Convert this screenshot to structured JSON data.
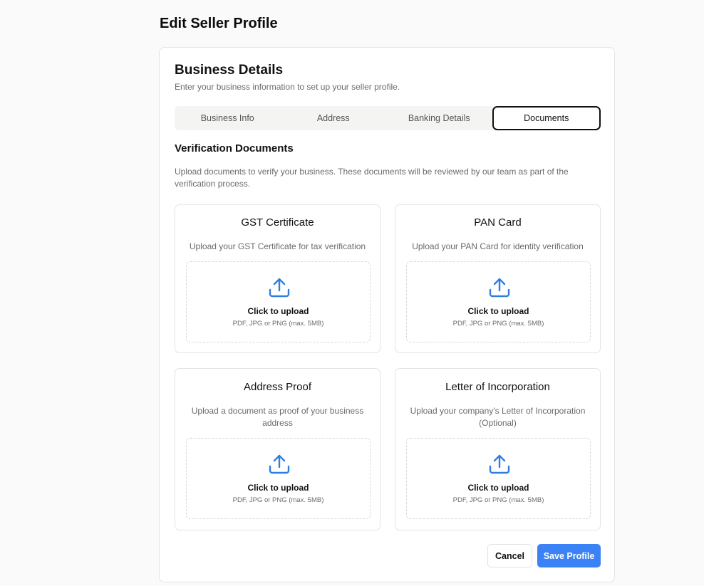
{
  "page": {
    "title": "Edit Seller Profile"
  },
  "card": {
    "title": "Business Details",
    "subtitle": "Enter your business information to set up your seller profile."
  },
  "tabs": [
    {
      "label": "Business Info",
      "active": false
    },
    {
      "label": "Address",
      "active": false
    },
    {
      "label": "Banking Details",
      "active": false
    },
    {
      "label": "Documents",
      "active": true
    }
  ],
  "section": {
    "title": "Verification Documents",
    "description": "Upload documents to verify your business. These documents will be reviewed by our team as part of the verification process."
  },
  "documents": [
    {
      "title": "GST Certificate",
      "description": "Upload your GST Certificate for tax verification",
      "upload_label": "Click to upload",
      "upload_hint": "PDF, JPG or PNG (max. 5MB)"
    },
    {
      "title": "PAN Card",
      "description": "Upload your PAN Card for identity verification",
      "upload_label": "Click to upload",
      "upload_hint": "PDF, JPG or PNG (max. 5MB)"
    },
    {
      "title": "Address Proof",
      "description": "Upload a document as proof of your business address",
      "upload_label": "Click to upload",
      "upload_hint": "PDF, JPG or PNG (max. 5MB)"
    },
    {
      "title": "Letter of Incorporation",
      "description": "Upload your company's Letter of Incorporation (Optional)",
      "upload_label": "Click to upload",
      "upload_hint": "PDF, JPG or PNG (max. 5MB)"
    }
  ],
  "icons": {
    "upload": "upload-icon"
  },
  "actions": {
    "cancel_label": "Cancel",
    "save_label": "Save Profile"
  },
  "colors": {
    "accent": "#3b82f6",
    "upload_icon": "#2f7de1"
  }
}
